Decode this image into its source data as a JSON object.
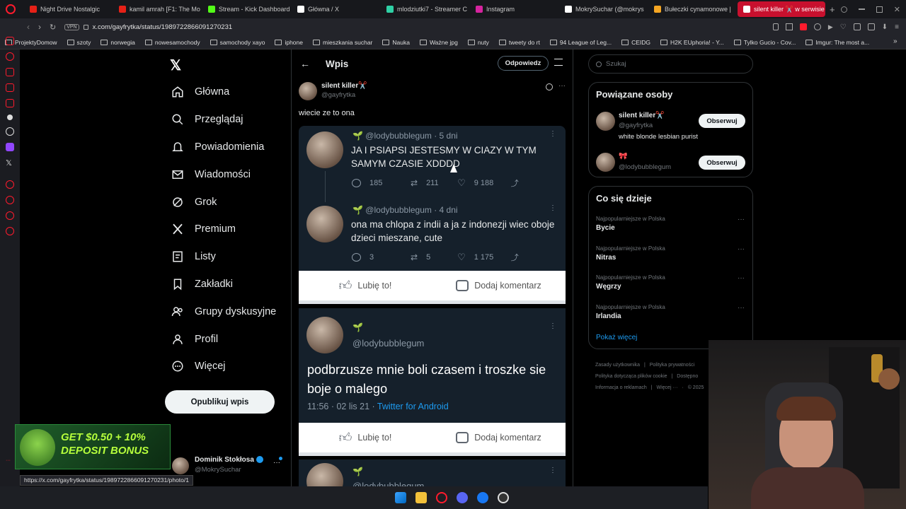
{
  "tabs": [
    {
      "label": "Night Drive Nostalgic",
      "color": "#e62117"
    },
    {
      "label": "kamil amrah [F1: The Mo",
      "color": "#e62117"
    },
    {
      "label": "Stream - Kick Dashboard",
      "color": "#53fc18"
    },
    {
      "label": "Główna / X",
      "color": "#ffffff"
    },
    {
      "label": "mlodziutki7 - Streamer C",
      "color": "#2fd0a5"
    },
    {
      "label": "Instagram",
      "color": "#d6249f"
    },
    {
      "label": "MokrySuchar (@mokrys",
      "color": "#ffffff"
    },
    {
      "label": "Bułeczki cynamonowe |",
      "color": "#f5a623"
    },
    {
      "label": "silent killer ✂️ w serwisie",
      "color": "#ffffff"
    }
  ],
  "address": {
    "url": "x.com/gayfrytka/status/1989722866091270231",
    "vpn": "VPN"
  },
  "bookmarks": [
    "ProjektyDomow",
    "szoty",
    "norwegia",
    "nowesamochody",
    "samochody xayo",
    "iphone",
    "mieszkania suchar",
    "Nauka",
    "Ważne jpg",
    "nuty",
    "tweety do rt",
    "94 League of Leg...",
    "CEIDG",
    "H2K EUphoria! - Y...",
    "Tylko Gucio - Cov...",
    "Imgur: The most a..."
  ],
  "nav": [
    {
      "label": "Główna",
      "icon": "home-icon"
    },
    {
      "label": "Przeglądaj",
      "icon": "search-icon"
    },
    {
      "label": "Powiadomienia",
      "icon": "bell-icon"
    },
    {
      "label": "Wiadomości",
      "icon": "mail-icon"
    },
    {
      "label": "Grok",
      "icon": "grok-icon"
    },
    {
      "label": "Premium",
      "icon": "x-logo-icon"
    },
    {
      "label": "Listy",
      "icon": "list-icon"
    },
    {
      "label": "Zakładki",
      "icon": "bookmark-icon"
    },
    {
      "label": "Grupy dyskusyjne",
      "icon": "people-icon"
    },
    {
      "label": "Profil",
      "icon": "person-icon"
    },
    {
      "label": "Więcej",
      "icon": "more-circle-icon"
    }
  ],
  "post_button": "Opublikuj wpis",
  "ad_text": "GET $0.50 + 10% DEPOSIT BONUS",
  "account": {
    "name": "Dominik Stokłosa",
    "handle": "@MokrySuchar"
  },
  "header": {
    "title": "Wpis",
    "reply": "Odpowiedz"
  },
  "post": {
    "name": "silent killer✂️",
    "handle": "@gayfrytka",
    "text": "wiecie ze to ona"
  },
  "embedded": [
    {
      "handle": "@lodybubblegum",
      "age": "· 5 dni",
      "text": "JA I PSIAPSI JESTESMY W CIAZY W TYM SAMYM CZASIE XDDDD",
      "replies": "185",
      "retweets": "211",
      "likes": "9 188"
    },
    {
      "handle": "@lodybubblegum",
      "age": "· 4 dni",
      "text": "ona ma chlopa z indii a ja z indonezji wiec oboje dzieci mieszane, cute",
      "replies": "3",
      "retweets": "5",
      "likes": "1 175"
    }
  ],
  "fb_bar": {
    "like": "Lubię to!",
    "comment": "Dodaj komentarz"
  },
  "old_tweet": {
    "handle": "@lodybubblegum",
    "text": "podbrzusze mnie boli czasem i troszke sie boje o malego",
    "time": "11:56 · 02 lis 21 ·",
    "source": "Twitter for Android"
  },
  "third_handle": "@lodybubblegum",
  "search_placeholder": "Szukaj",
  "related": {
    "title": "Powiązane osoby",
    "people": [
      {
        "name": "silent killer✂️",
        "handle": "@gayfrytka",
        "bio": "white blonde lesbian purist",
        "button": "Obserwuj"
      },
      {
        "name": "🎀",
        "handle": "@lodybubblegum",
        "bio": "",
        "button": "Obserwuj"
      }
    ]
  },
  "trends": {
    "title": "Co się dzieje",
    "items": [
      {
        "label": "Najpopularniejsze w Polska",
        "name": "Bycie"
      },
      {
        "label": "Najpopularniejsze w Polska",
        "name": "Nitras"
      },
      {
        "label": "Najpopularniejsze w Polska",
        "name": "Węgrzy"
      },
      {
        "label": "Najpopularniejsze w Polska",
        "name": "Irlandia"
      }
    ],
    "more": "Pokaż więcej"
  },
  "footer": [
    "Zasady użytkownika",
    "Polityka prywatności",
    "Polityka dotycząca plików cookie",
    "Dostępno",
    "Informacja o reklamach",
    "Więcej ···",
    "© 2025"
  ],
  "status_url": "https://x.com/gayfrytka/status/1989722866091270231/photo/1",
  "colors": {
    "accent": "#1d9bf0",
    "tab_active": "#c8102e"
  }
}
